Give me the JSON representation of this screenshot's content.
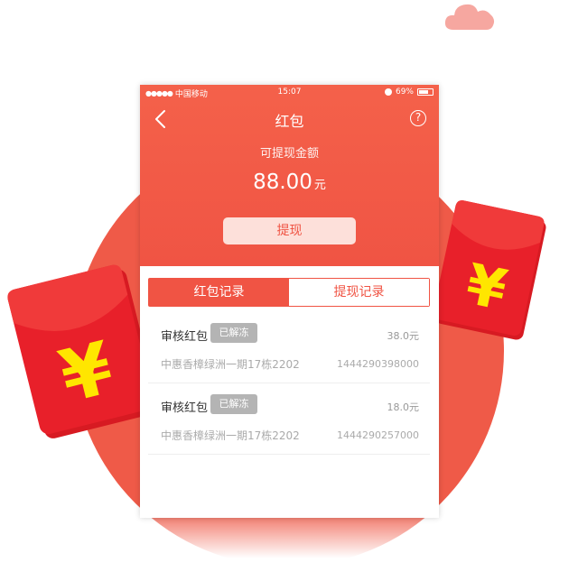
{
  "status_bar": {
    "carrier": "中国移动",
    "time": "15:07",
    "battery": "69%"
  },
  "header": {
    "title": "红包",
    "help_label": "?",
    "subtitle": "可提现金额",
    "amount": "88.00",
    "amount_unit": "元",
    "withdraw_label": "提现"
  },
  "tabs": [
    {
      "label": "红包记录",
      "active": true
    },
    {
      "label": "提现记录",
      "active": false
    }
  ],
  "records": [
    {
      "name": "审核红包",
      "badge": "已解冻",
      "amount": "38.0元",
      "address": "中惠香樟绿洲一期17栋2202",
      "id": "1444290398000"
    },
    {
      "name": "审核红包",
      "badge": "已解冻",
      "amount": "18.0元",
      "address": "中惠香樟绿洲一期17栋2202",
      "id": "1444290257000"
    }
  ],
  "decor": {
    "yuan_symbol": "¥",
    "colors": {
      "primary": "#f05444",
      "envelope": "#e8202a",
      "yuan": "#ffe600",
      "cloud": "#f6a7a0"
    }
  }
}
